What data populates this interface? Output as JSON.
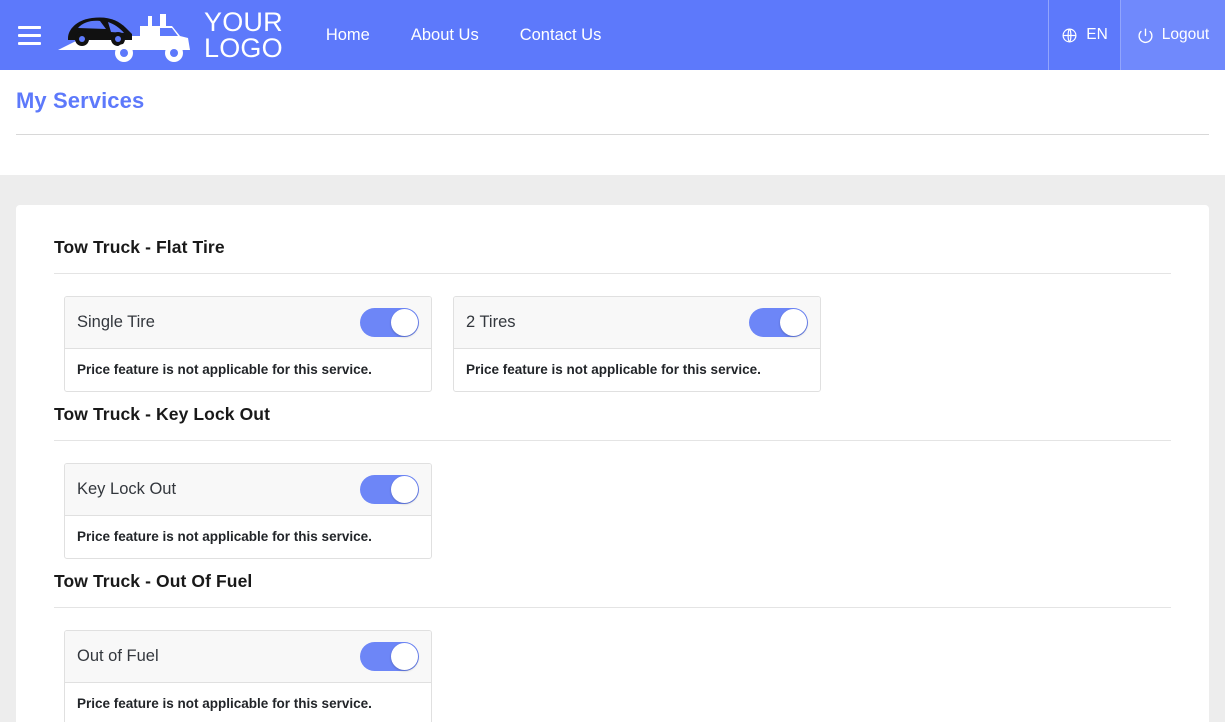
{
  "header": {
    "menu_icon": "hamburger-menu-icon",
    "logo": {
      "icon": "tow-truck-logo-icon",
      "line1": "YOUR",
      "line2": "LOGO"
    },
    "nav_links": [
      {
        "label": "Home"
      },
      {
        "label": "About Us"
      },
      {
        "label": "Contact Us"
      }
    ],
    "language": {
      "icon": "globe-icon",
      "label": "EN"
    },
    "logout": {
      "icon": "power-icon",
      "label": "Logout"
    },
    "background_color": "#5d79fb",
    "logout_background_color": "#7089fc"
  },
  "page": {
    "title": "My Services",
    "title_color": "#5d79fb",
    "background_color": "#ededed"
  },
  "service_groups": [
    {
      "title": "Tow Truck - Flat Tire",
      "services": [
        {
          "name": "Single Tire",
          "enabled": true,
          "price_note": "Price feature is not applicable for this service."
        },
        {
          "name": "2 Tires",
          "enabled": true,
          "price_note": "Price feature is not applicable for this service."
        }
      ]
    },
    {
      "title": "Tow Truck - Key Lock Out",
      "services": [
        {
          "name": "Key Lock Out",
          "enabled": true,
          "price_note": "Price feature is not applicable for this service."
        }
      ]
    },
    {
      "title": "Tow Truck - Out Of Fuel",
      "services": [
        {
          "name": "Out of Fuel",
          "enabled": true,
          "price_note": "Price feature is not applicable for this service."
        }
      ]
    }
  ],
  "colors": {
    "accent": "#5d79fb",
    "toggle_on": "#6d86f7",
    "card_header": "#f8f8f8",
    "border": "#e0e0e0"
  }
}
